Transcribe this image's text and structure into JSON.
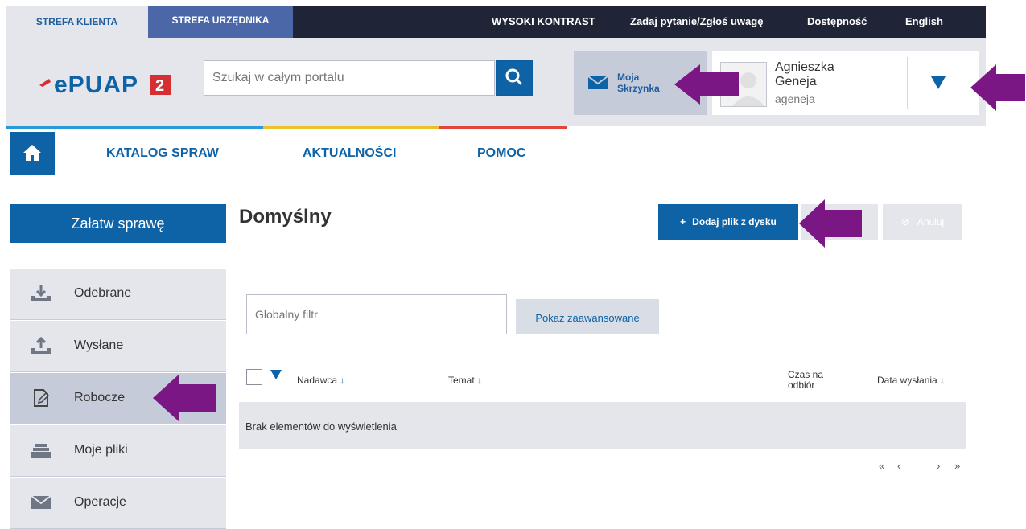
{
  "topbar": {
    "zone_client": "STREFA KLIENTA",
    "zone_official": "STREFA URZĘDNIKA",
    "high_contrast": "WYSOKI KONTRAST",
    "ask_question": "Zadaj pytanie/Zgłoś uwagę",
    "accessibility": "Dostępność",
    "language": "English"
  },
  "header": {
    "logo_text": "ePUAP",
    "logo_version": "2",
    "search_placeholder": "Szukaj w całym portalu",
    "mailbox_label_1": "Moja",
    "mailbox_label_2": "Skrzynka",
    "user_first_name": "Agnieszka",
    "user_last_name": "Geneja",
    "user_login": "ageneja"
  },
  "nav": {
    "items": [
      {
        "label": "KATALOG SPRAW"
      },
      {
        "label": "AKTUALNOŚCI"
      },
      {
        "label": "POMOC"
      }
    ]
  },
  "sidebar": {
    "primary_button": "Załatw sprawę",
    "items": [
      {
        "label": "Odebrane",
        "icon": "inbox-download-icon"
      },
      {
        "label": "Wysłane",
        "icon": "outbox-upload-icon"
      },
      {
        "label": "Robocze",
        "icon": "draft-edit-icon",
        "active": true
      },
      {
        "label": "Moje pliki",
        "icon": "files-tray-icon"
      },
      {
        "label": "Operacje",
        "icon": "envelope-icon"
      }
    ]
  },
  "main": {
    "title": "Domyślny",
    "add_file_button": "Dodaj plik z dysku",
    "cancel_button": "Anuluj",
    "filter_placeholder": "Globalny filtr",
    "advanced_button": "Pokaż zaawansowane",
    "columns": {
      "sender": "Nadawca",
      "subject": "Temat",
      "pickup_time_1": "Czas na",
      "pickup_time_2": "odbiór",
      "sent_date": "Data wysłania"
    },
    "sort_arrow": "↓",
    "empty_message": "Brak elementów do wyświetlenia",
    "pager": {
      "first": "«",
      "prev": "‹",
      "next": "›",
      "last": "»"
    }
  },
  "colors": {
    "brand_blue": "#0e63a7",
    "dark_bar": "#1f2536",
    "light_grey": "#e4e6ec",
    "highlight_arrow": "#7b1685",
    "stripe_blue": "#2a9bd8",
    "stripe_yellow": "#e9c12b",
    "stripe_red": "#e2453c",
    "logo_red": "#d62f33"
  }
}
